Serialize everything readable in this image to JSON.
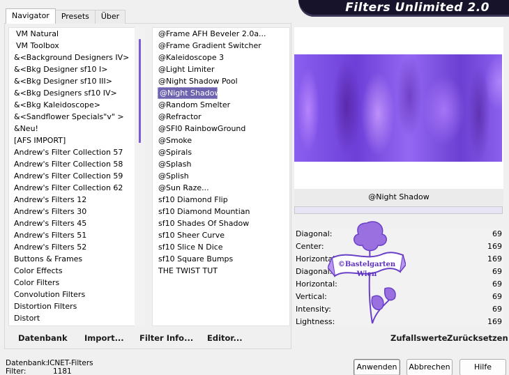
{
  "tabs": [
    "Navigator",
    "Presets",
    "Über"
  ],
  "title": "Filters Unlimited 2.0",
  "categories": [
    "VM Natural",
    "VM Toolbox",
    "&<Background Designers IV>",
    "&<Bkg Designer sf10 I>",
    "&<Bkg Designer sf10 III>",
    "&<Bkg Designers sf10 IV>",
    "&<Bkg Kaleidoscope>",
    "&<Sandflower Specials\"v\" >",
    "&Neu!",
    "[AFS IMPORT]",
    "Andrew's Filter Collection 57",
    "Andrew's Filter Collection 58",
    "Andrew's Filter Collection 59",
    "Andrew's Filter Collection 62",
    "Andrew's Filters 12",
    "Andrew's Filters 30",
    "Andrew's Filters 45",
    "Andrew's Filters 51",
    "Andrew's Filters 52",
    "Buttons & Frames",
    "Color Effects",
    "Color Filters",
    "Convolution Filters",
    "Distortion Filters",
    "Distort"
  ],
  "filters": [
    "@Frame AFH Beveler 2.0a...",
    "@Frame Gradient Switcher",
    "@Kaleidoscope 3",
    "@Light Limiter",
    "@Night Shadow Pool",
    "@Night Shadow",
    "@Random Smelter",
    "@Refractor",
    "@SFI0 RainbowGround",
    "@Smoke",
    "@Spirals",
    "@Splash",
    "@Splish",
    "@Sun Raze...",
    "sf10 Diamond Flip",
    "sf10 Diamond Mountian",
    "sf10 Shades Of Shadow",
    "sf10 Sheer Curve",
    "sf10 Slice N Dice",
    "sf10 Square Bumps",
    "THE TWIST TUT"
  ],
  "links": {
    "database": "Datenbank",
    "import": "Import...",
    "filter_info": "Filter Info...",
    "editor": "Editor...",
    "random": "Zufallswerte",
    "reset": "Zurücksetzen"
  },
  "preview": {
    "filter_name": "@Night Shadow",
    "progress": 0
  },
  "params": [
    {
      "label": "Diagonal:",
      "value": "69"
    },
    {
      "label": "Center:",
      "value": "169"
    },
    {
      "label": "Horizontal:",
      "value": "169"
    },
    {
      "label": "Diagonal:",
      "value": "69"
    },
    {
      "label": "Horizontal:",
      "value": "69"
    },
    {
      "label": "Vertical:",
      "value": "69"
    },
    {
      "label": "Intensity:",
      "value": "69"
    },
    {
      "label": "Lightness:",
      "value": "169"
    }
  ],
  "watermark": {
    "line1": "©Bastelgarten",
    "line2": "Wien"
  },
  "status": {
    "database_label": "Datenbank:",
    "database_value": "ICNET-Filters",
    "filter_label": "Filter:",
    "filter_value": "1181"
  },
  "buttons": {
    "apply": "Anwenden",
    "cancel": "Abbrechen",
    "help": "Hilfe"
  },
  "colors": {
    "accent": "#6d63ae",
    "banner": "#17132a",
    "preview": "#8b5ff0"
  }
}
